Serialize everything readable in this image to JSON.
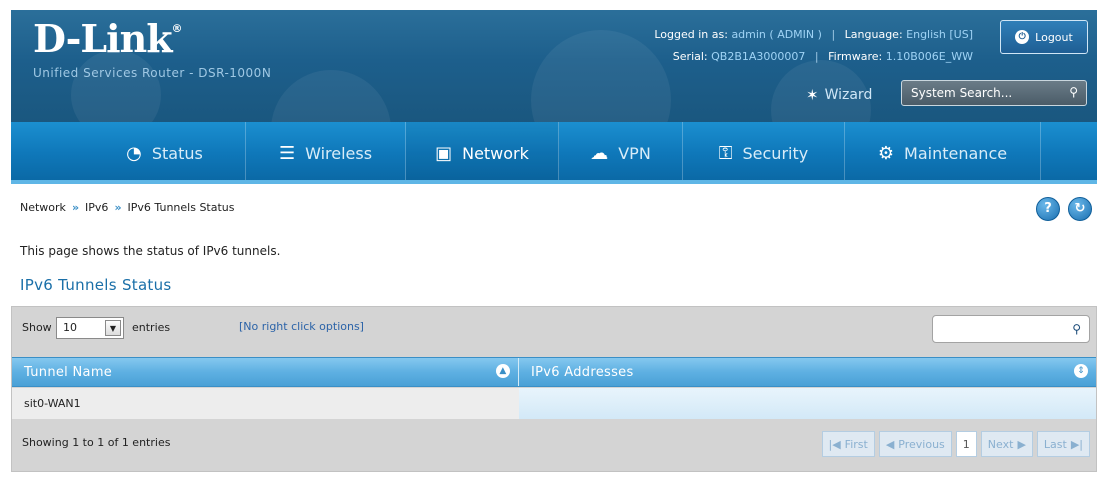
{
  "header": {
    "logo": "D-Link",
    "logo_mark": "®",
    "product": "Unified Services Router - DSR-1000N",
    "logged_in_label": "Logged in as:",
    "logged_in_user": "admin ( ADMIN )",
    "language_label": "Language:",
    "language_value": "English [US]",
    "serial_label": "Serial:",
    "serial_value": "QB2B1A3000007",
    "firmware_label": "Firmware:",
    "firmware_value": "1.10B006E_WW",
    "logout_label": "Logout",
    "wizard_label": "Wizard",
    "search_placeholder": "System Search..."
  },
  "nav": {
    "items": [
      {
        "label": "Status",
        "icon": "gauge-icon"
      },
      {
        "label": "Wireless",
        "icon": "wifi-icon"
      },
      {
        "label": "Network",
        "icon": "monitor-icon",
        "active": true
      },
      {
        "label": "VPN",
        "icon": "cloud-lock-icon"
      },
      {
        "label": "Security",
        "icon": "lock-icon"
      },
      {
        "label": "Maintenance",
        "icon": "gears-icon"
      }
    ]
  },
  "breadcrumb": [
    "Network",
    "IPv6",
    "IPv6 Tunnels Status"
  ],
  "breadcrumb_sep": "»",
  "page": {
    "description": "This page shows the status of IPv6 tunnels.",
    "section_title": "IPv6 Tunnels Status"
  },
  "table": {
    "show_label": "Show",
    "entries_value": "10",
    "entries_label": "entries",
    "no_right_click": "[No right click options]",
    "columns": [
      "Tunnel Name",
      "IPv6 Addresses"
    ],
    "rows": [
      {
        "name": "sit0-WAN1",
        "addresses": ""
      }
    ],
    "info": "Showing 1 to 1 of 1 entries",
    "pager": {
      "first": "First",
      "previous": "Previous",
      "current": "1",
      "next": "Next",
      "last": "Last"
    }
  },
  "colors": {
    "header_bg": "#1d5f8c",
    "nav_bg": "#0f78ba",
    "table_header": "#5eb0e2",
    "accent_text": "#1a6fa8"
  }
}
